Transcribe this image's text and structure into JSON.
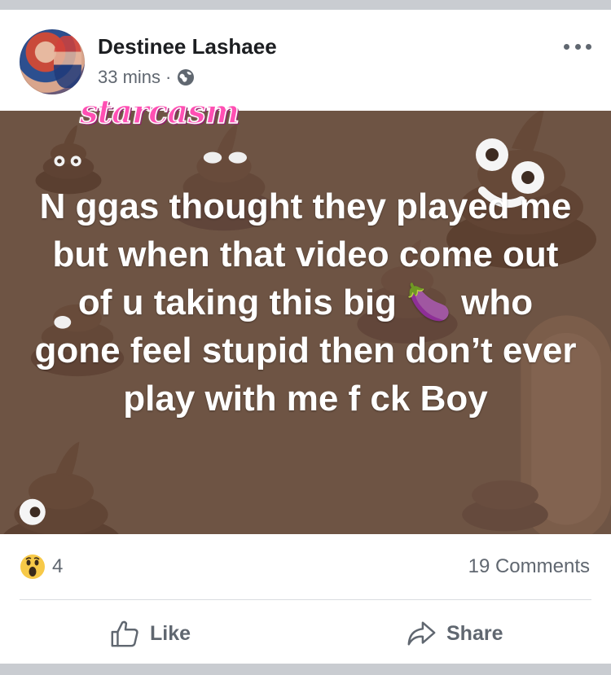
{
  "post": {
    "author": "Destinee Lashaee",
    "time": "33 mins",
    "separator": "·",
    "privacy_icon": "globe-icon",
    "more_icon": "more-options-icon"
  },
  "watermark": "starcasm",
  "banner": {
    "background_color": "#6e5444",
    "text": "N ggas thought they played me but when that video come out of u taking this big 🍆 who gone feel stupid then don’t ever play with me f ck Boy",
    "emoji_pattern": "pile-of-poo-icon"
  },
  "stats": {
    "reaction_icon": "wow-reaction-icon",
    "reaction_count": "4",
    "comments": "19 Comments"
  },
  "actions": {
    "like_label": "Like",
    "share_label": "Share"
  }
}
